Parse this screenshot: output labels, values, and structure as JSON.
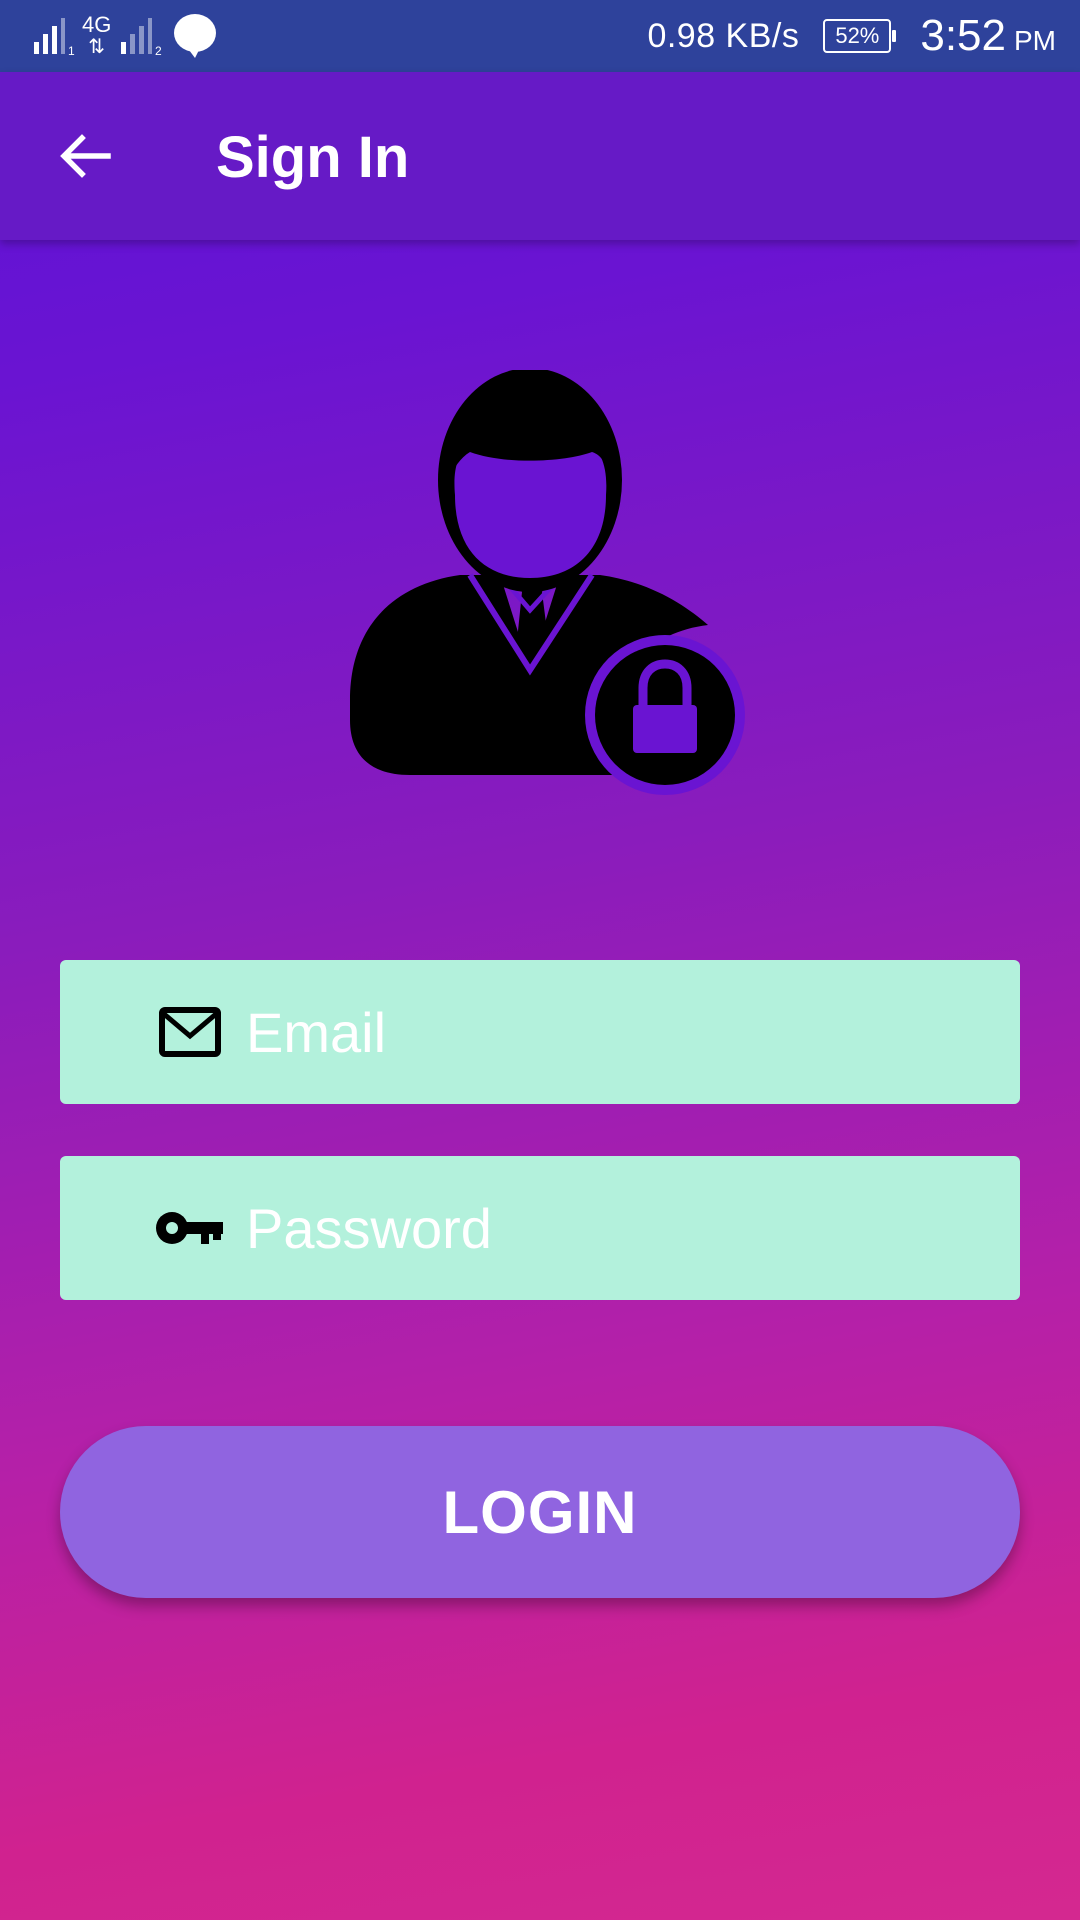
{
  "status_bar": {
    "sim1_label": "1",
    "network_type": "4G",
    "sim2_label": "2",
    "net_speed": "0.98 KB/s",
    "battery_percent": "52%",
    "time": "3:52",
    "ampm": "PM"
  },
  "app_bar": {
    "title": "Sign In",
    "back_icon": "arrow-left-icon"
  },
  "avatar": {
    "icon": "user-lock-icon"
  },
  "form": {
    "email": {
      "placeholder": "Email",
      "value": "",
      "icon": "mail-icon"
    },
    "password": {
      "placeholder": "Password",
      "value": "",
      "icon": "key-icon"
    },
    "login_label": "LOGIN"
  },
  "colors": {
    "status_bar_bg": "#2e429b",
    "app_bar_bg": "#661ac6",
    "gradient_top": "#5a12d6",
    "gradient_bottom": "#d42890",
    "field_bg": "#b3f1dc",
    "login_button_bg": "#9064e0"
  }
}
